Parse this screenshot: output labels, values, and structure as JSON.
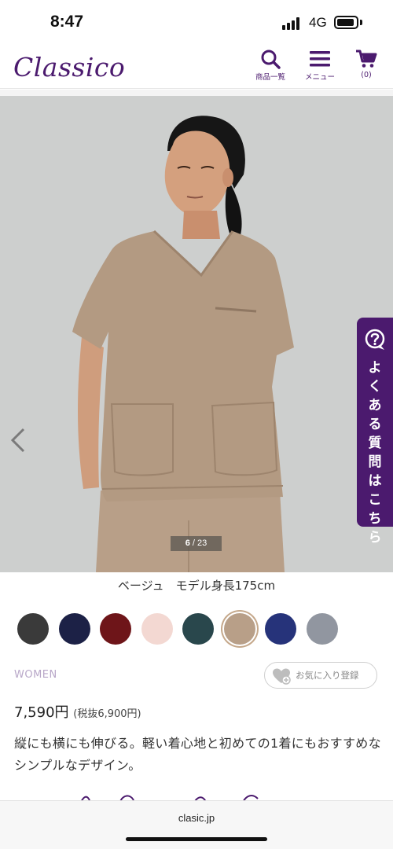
{
  "status_bar": {
    "time": "8:47",
    "network": "4G"
  },
  "header": {
    "logo": "Classico",
    "search_label": "商品一覧",
    "menu_label": "メニュー",
    "cart_label": "(0)"
  },
  "hero": {
    "current_image": "6",
    "total_images": "/ 23",
    "icons": [
      "chevron-left-icon"
    ]
  },
  "faq_tab": {
    "label": "よくある質問はこちら"
  },
  "caption": "ベージュ　モデル身長175cm",
  "swatches": [
    {
      "color": "#3a3a3a"
    },
    {
      "color": "#1c2146"
    },
    {
      "color": "#6e1519"
    },
    {
      "color": "#f3d8d2"
    },
    {
      "color": "#29474c"
    },
    {
      "color": "#b89f88",
      "selected": true
    },
    {
      "color": "#26337a"
    },
    {
      "color": "#9196a0"
    }
  ],
  "product": {
    "category": "WOMEN",
    "favorite_label": "お気に入り登録",
    "price": "7,590円",
    "price_tax": "(税抜6,900円)",
    "description": "縦にも横にも伸びる。軽い着心地と初めての1着にもおすすめなシンプルなデザイン。"
  },
  "browser": {
    "url": "clasic.jp"
  },
  "colors": {
    "brand": "#4b1a6e",
    "selected_ring": "#c5a88b"
  }
}
